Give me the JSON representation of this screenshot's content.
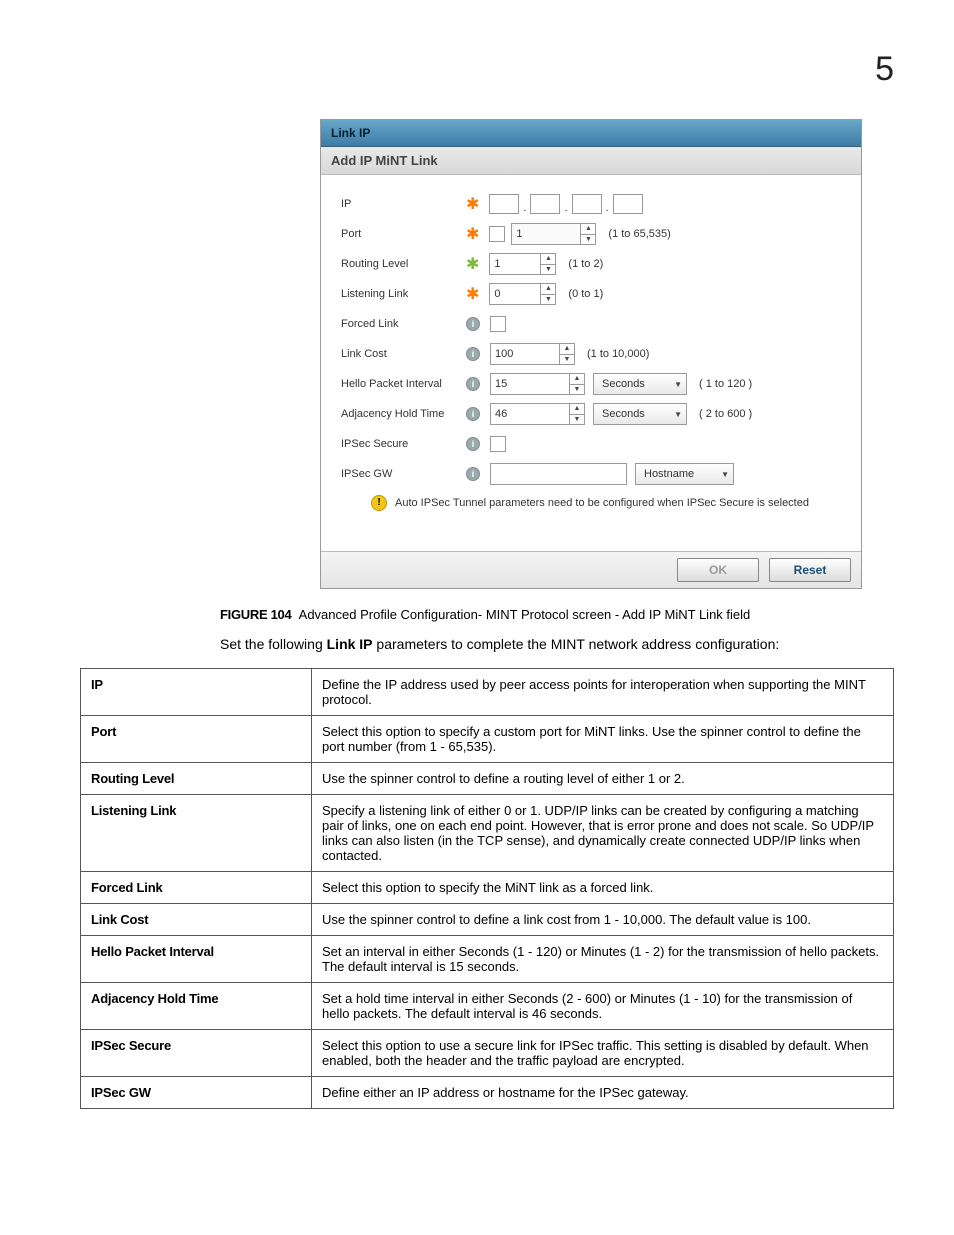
{
  "page_number": "5",
  "dialog": {
    "title": "Link IP",
    "subtitle": "Add IP MiNT Link",
    "fields": {
      "ip_label": "IP",
      "port_label": "Port",
      "port_value": "1",
      "port_hint": "(1 to 65,535)",
      "routing_label": "Routing Level",
      "routing_value": "1",
      "routing_hint": "(1 to 2)",
      "listening_label": "Listening Link",
      "listening_value": "0",
      "listening_hint": "(0 to 1)",
      "forced_label": "Forced Link",
      "linkcost_label": "Link Cost",
      "linkcost_value": "100",
      "linkcost_hint": "(1 to 10,000)",
      "hello_label": "Hello Packet Interval",
      "hello_value": "15",
      "hello_unit": "Seconds",
      "hello_hint": "( 1 to 120 )",
      "adj_label": "Adjacency Hold Time",
      "adj_value": "46",
      "adj_unit": "Seconds",
      "adj_hint": "( 2 to 600 )",
      "ipsec_label": "IPSec Secure",
      "ipsecgw_label": "IPSec GW",
      "ipsecgw_type": "Hostname"
    },
    "warning": "Auto IPSec Tunnel parameters need to be configured when IPSec Secure is selected",
    "buttons": {
      "ok": "OK",
      "reset": "Reset"
    }
  },
  "figure": {
    "number": "FIGURE 104",
    "text": "Advanced Profile Configuration- MINT Protocol screen - Add IP MiNT Link field"
  },
  "intro_pre": "Set the following ",
  "intro_bold": "Link IP",
  "intro_post": " parameters to complete the MINT network address configuration:",
  "params": [
    {
      "name": "IP",
      "desc": "Define the IP address used by peer access points for interoperation when supporting the MINT protocol."
    },
    {
      "name": "Port",
      "desc": "Select this option to specify a custom port for MiNT links. Use the spinner control to define the port number (from 1 - 65,535)."
    },
    {
      "name": "Routing Level",
      "desc": "Use the spinner control to define a routing level of either 1 or 2."
    },
    {
      "name": "Listening Link",
      "desc": "Specify a listening link of either 0 or 1. UDP/IP links can be created by configuring a matching pair of links, one on each end point. However, that is error prone and does not scale. So UDP/IP links can also listen (in the TCP sense), and dynamically create connected UDP/IP links when contacted."
    },
    {
      "name": "Forced Link",
      "desc": "Select this option to specify the MiNT link as a forced link."
    },
    {
      "name": "Link Cost",
      "desc": "Use the spinner control to define a link cost from 1 - 10,000. The default value is 100."
    },
    {
      "name": "Hello Packet Interval",
      "desc": "Set an interval in either Seconds (1 - 120) or Minutes (1 - 2) for the transmission of hello packets. The default interval is 15 seconds."
    },
    {
      "name": "Adjacency Hold Time",
      "desc": "Set a hold time interval in either Seconds (2 - 600) or Minutes (1 - 10) for the transmission of hello packets. The default interval is 46 seconds."
    },
    {
      "name": "IPSec Secure",
      "desc": "Select this option to use a secure link for IPSec traffic. This setting is disabled by default. When enabled, both the header and the traffic payload are encrypted."
    },
    {
      "name": "IPSec GW",
      "desc": "Define either an IP address or hostname for the IPSec gateway."
    }
  ]
}
